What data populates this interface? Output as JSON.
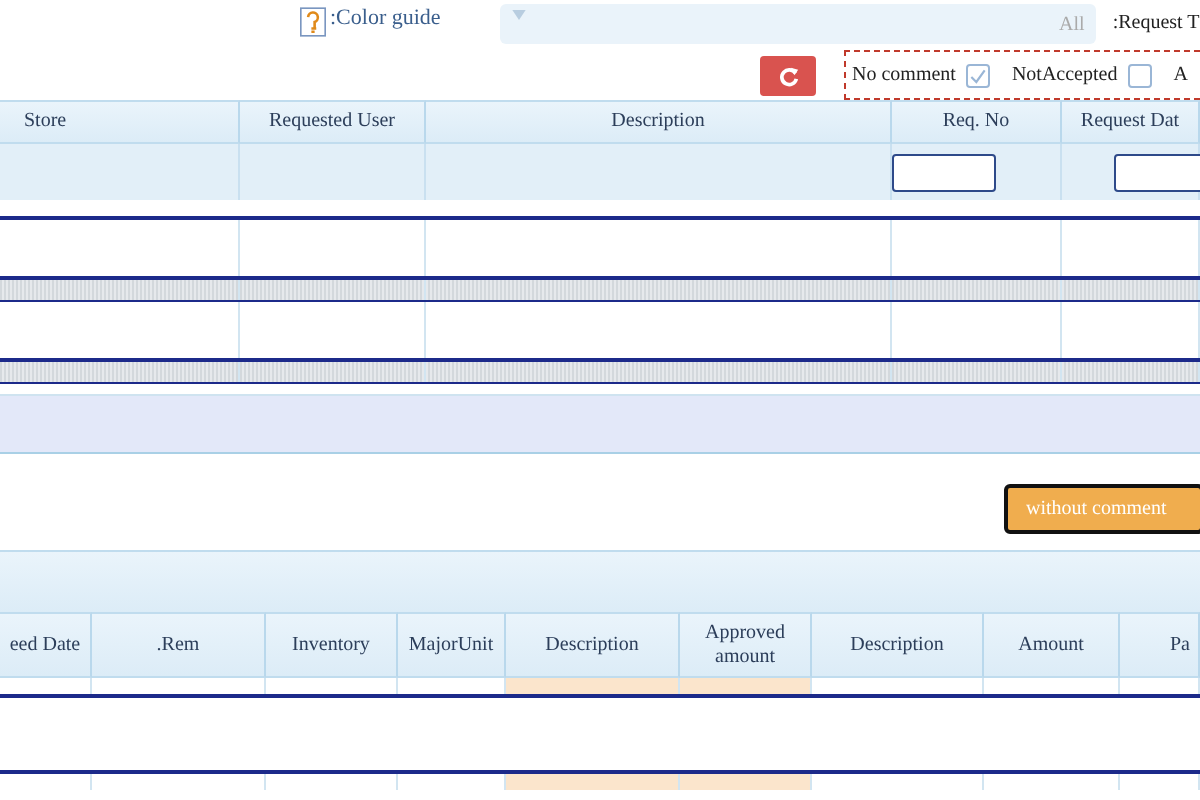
{
  "toolbar": {
    "color_guide": ":Color guide",
    "request_type": {
      "value": "All",
      "label": ":Request T"
    }
  },
  "filters": [
    {
      "label": "No comment",
      "checked": true
    },
    {
      "label": "NotAccepted",
      "checked": false
    },
    {
      "label": "A"
    }
  ],
  "requests_table": {
    "columns": [
      {
        "label": "Store",
        "filter": false
      },
      {
        "label": "Requested User",
        "filter": false
      },
      {
        "label": "Description",
        "filter": false
      },
      {
        "label": "Req. No",
        "filter": true
      },
      {
        "label": "Request Dat",
        "filter": true
      }
    ]
  },
  "without_comment_button": "without comment",
  "items_table": {
    "columns": [
      {
        "label": "eed Date",
        "highlighted": false
      },
      {
        "label": ".Rem",
        "highlighted": false
      },
      {
        "label": "Inventory",
        "highlighted": false
      },
      {
        "label": "MajorUnit",
        "highlighted": false
      },
      {
        "label": "Description",
        "highlighted": true
      },
      {
        "label": "Approved amount",
        "highlighted": true
      },
      {
        "label": "Description",
        "highlighted": false
      },
      {
        "label": "Amount",
        "highlighted": false
      },
      {
        "label": "Pa",
        "highlighted": false
      }
    ]
  }
}
